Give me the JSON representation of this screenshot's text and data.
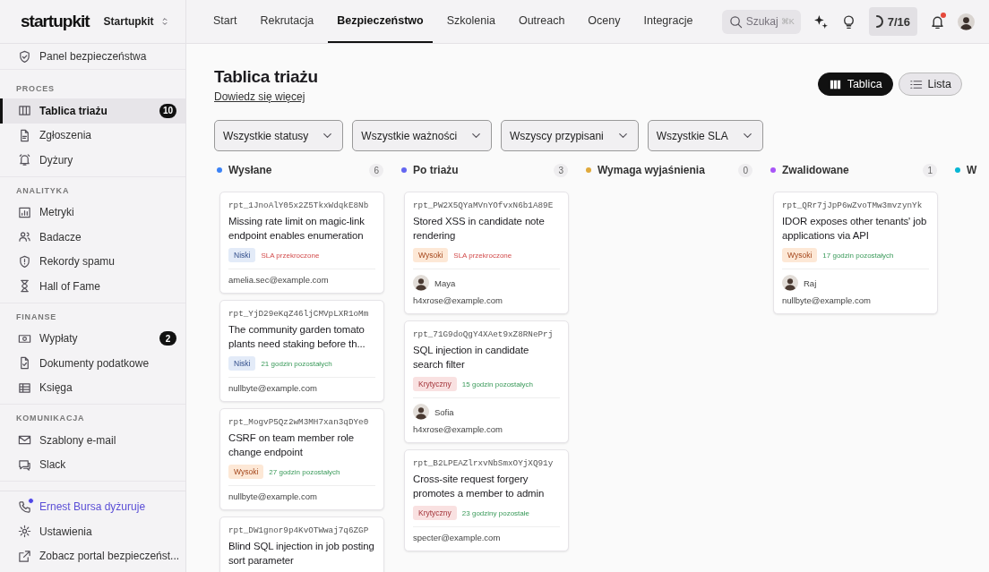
{
  "brand": {
    "logo": "startupkit",
    "workspace": "Startupkit"
  },
  "nav_tabs": [
    {
      "label": "Start",
      "selected": false
    },
    {
      "label": "Rekrutacja",
      "selected": false
    },
    {
      "label": "Bezpieczeństwo",
      "selected": true
    },
    {
      "label": "Szkolenia",
      "selected": false
    },
    {
      "label": "Outreach",
      "selected": false
    },
    {
      "label": "Oceny",
      "selected": false
    },
    {
      "label": "Integracje",
      "selected": false
    }
  ],
  "search": {
    "placeholder": "Szukaj",
    "shortcut": "⌘K"
  },
  "progress": {
    "text": "7/16"
  },
  "notifications": {
    "unread": true
  },
  "sidebar": {
    "top_item": {
      "label": "Panel bezpieczeństwa",
      "selected": false
    },
    "sections": [
      {
        "title": "PROCES",
        "items": [
          {
            "label": "Tablica triażu",
            "selected": true,
            "badge": "10"
          },
          {
            "label": "Zgłoszenia",
            "selected": false
          },
          {
            "label": "Dyżury",
            "selected": false
          }
        ]
      },
      {
        "title": "ANALITYKA",
        "items": [
          {
            "label": "Metryki",
            "selected": false
          },
          {
            "label": "Badacze",
            "selected": false
          },
          {
            "label": "Rekordy spamu",
            "selected": false
          },
          {
            "label": "Hall of Fame",
            "selected": false
          }
        ]
      },
      {
        "title": "FINANSE",
        "items": [
          {
            "label": "Wypłaty",
            "selected": false,
            "badge": "2"
          },
          {
            "label": "Dokumenty podatkowe",
            "selected": false
          },
          {
            "label": "Księga",
            "selected": false
          }
        ]
      },
      {
        "title": "KOMUNIKACJA",
        "items": [
          {
            "label": "Szablony e-mail",
            "selected": false
          },
          {
            "label": "Slack",
            "selected": false
          }
        ]
      }
    ],
    "footer": [
      {
        "kind": "oncall",
        "label": "Ernest Bursa dyżuruje",
        "active": true
      },
      {
        "kind": "settings",
        "label": "Ustawienia"
      },
      {
        "kind": "external",
        "label": "Zobacz portal bezpieczeńst..."
      }
    ]
  },
  "page": {
    "title": "Tablica triażu",
    "link": "Dowiedz się więcej",
    "views": [
      {
        "label": "Tablica",
        "selected": true
      },
      {
        "label": "Lista",
        "selected": false
      }
    ],
    "filters": [
      "Wszystkie statusy",
      "Wszystkie ważności",
      "Wszyscy przypisani",
      "Wszystkie SLA"
    ]
  },
  "columns": [
    {
      "title": "Wysłane",
      "color": "#3b82f6",
      "count": "6",
      "cards": [
        {
          "id": "rpt_1JnoAlY05x2Z5TkxWdqkE8Nb",
          "title": "Missing rate limit on magic-link endpoint enables enumeration",
          "severity": "Niski",
          "kind": "low",
          "sla": "SLA przekroczone",
          "overdue": true,
          "email": "amelia.sec@example.com"
        },
        {
          "id": "rpt_YjD29eKqZ46ljCMVpLXR1oMm",
          "title": "The community garden tomato plants need staking before th...",
          "severity": "Niski",
          "kind": "low",
          "sla": "21 godzin pozostałych",
          "overdue": false,
          "email": "nullbyte@example.com"
        },
        {
          "id": "rpt_MogvP5Qz2wM3MH7xan3qDYe0",
          "title": "CSRF on team member role change endpoint",
          "severity": "Wysoki",
          "kind": "high",
          "sla": "27 godzin pozostałych",
          "overdue": false,
          "email": "nullbyte@example.com"
        },
        {
          "id": "rpt_DW1gnor9p4KvOTWwaj7q6ZGP",
          "title": "Blind SQL injection in job posting sort parameter"
        }
      ]
    },
    {
      "title": "Po triażu",
      "color": "#6366f1",
      "count": "3",
      "cards": [
        {
          "id": "rpt_PW2X5QYaMVnYOfvxN6b1A89E",
          "title": "Stored XSS in candidate note rendering",
          "severity": "Wysoki",
          "kind": "high",
          "sla": "SLA przekroczone",
          "overdue": true,
          "assignee": "Maya",
          "email": "h4xrose@example.com"
        },
        {
          "id": "rpt_71G9doQgY4XAet9xZ8RNePrj",
          "title": "SQL injection in candidate search filter",
          "severity": "Krytyczny",
          "kind": "critical",
          "sla": "15 godzin pozostałych",
          "overdue": false,
          "assignee": "Sofia",
          "email": "h4xrose@example.com"
        },
        {
          "id": "rpt_B2LPEAZlrxvNbSmxOYjXQ91y",
          "title": "Cross-site request forgery promotes a member to admin",
          "severity": "Krytyczny",
          "kind": "critical",
          "sla": "23 godziny pozostałe",
          "overdue": false,
          "email": "specter@example.com"
        }
      ]
    },
    {
      "title": "Wymaga wyjaśnienia",
      "color": "#e0a93b",
      "count": "0"
    },
    {
      "title": "Zwalidowane",
      "color": "#a855f7",
      "count": "1",
      "cards": [
        {
          "id": "rpt_QRr7jJpP6wZvoTMw3mvzynYk",
          "title": "IDOR exposes other tenants' job applications via API",
          "severity": "Wysoki",
          "kind": "high",
          "sla": "17 godzin pozostałych",
          "overdue": false,
          "assignee": "Raj",
          "email": "nullbyte@example.com"
        }
      ]
    },
    {
      "title": "W",
      "color": "#06b6d4"
    }
  ]
}
